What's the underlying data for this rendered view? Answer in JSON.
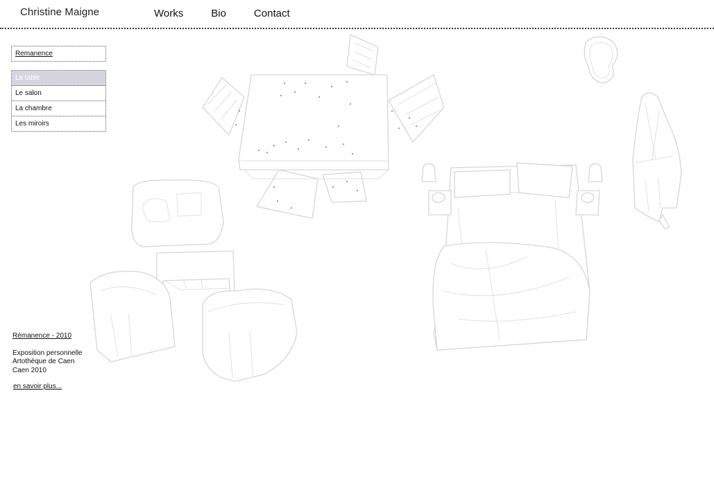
{
  "header": {
    "site_name": "Christine Maigne",
    "nav": [
      {
        "label": "Works"
      },
      {
        "label": "Bio"
      },
      {
        "label": "Contact"
      }
    ]
  },
  "sidebar": {
    "project": {
      "label": "Remanence"
    },
    "rooms": [
      {
        "label": "La table",
        "active": true
      },
      {
        "label": "Le salon"
      },
      {
        "label": "La chambre"
      },
      {
        "label": "Les miroirs"
      }
    ]
  },
  "info": {
    "title": "Rémanence - 2010",
    "lines": [
      "Exposition personnelle",
      "Artothèque de Caen",
      "Caen 2010"
    ],
    "more_link": "en savoir plus..."
  },
  "colors": {
    "active_menu_bg": "#d4d6df",
    "outline": "#d6d6d6"
  }
}
